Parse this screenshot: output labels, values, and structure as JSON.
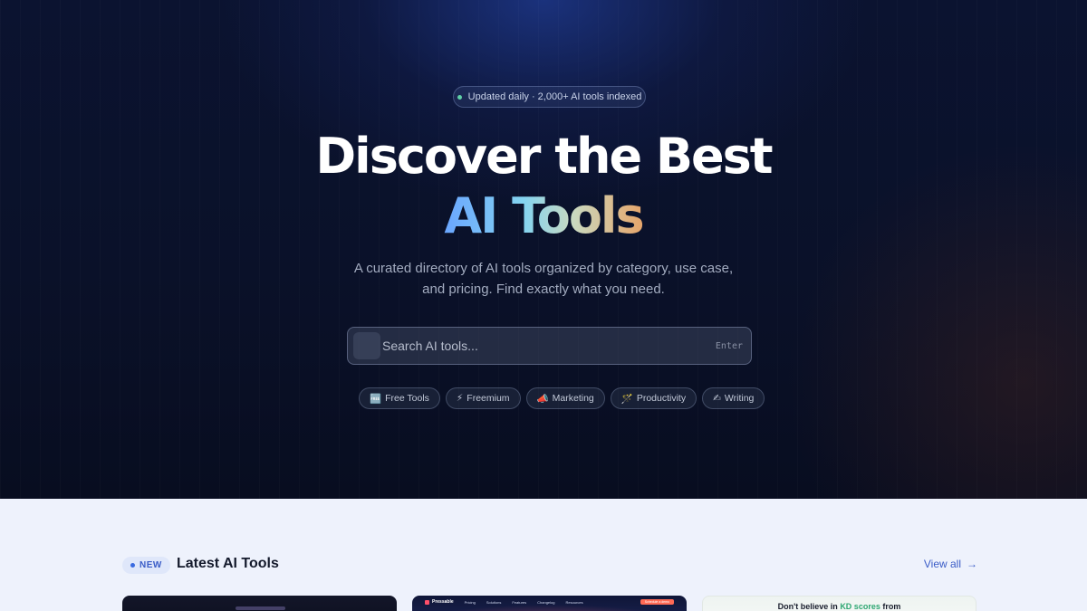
{
  "hero": {
    "badge": "Updated daily · 2,000+ AI tools indexed",
    "headline_line1": "Discover the Best",
    "headline_line2": "AI Tools",
    "subtitle_line1": "A curated directory of AI tools organized by category, use case,",
    "subtitle_line2": "and pricing. Find exactly what you need.",
    "search": {
      "placeholder": "Search AI tools...",
      "shortcut": "Enter"
    },
    "chips": [
      {
        "icon": "🆓",
        "label": "Free Tools"
      },
      {
        "icon": "⚡",
        "label": "Freemium"
      },
      {
        "icon": "📣",
        "label": "Marketing"
      },
      {
        "icon": "🪄",
        "label": "Productivity"
      },
      {
        "icon": "✍",
        "label": "Writing"
      }
    ]
  },
  "latest": {
    "badge": "NEW",
    "title": "Latest AI Tools",
    "view_all": "View all",
    "view_all_arrow": "→",
    "cards": [
      {
        "preview": "dark"
      },
      {
        "preview": "site",
        "brand": "Pressable",
        "nav": [
          "Pricing",
          "Solutions",
          "Features",
          "Changelog",
          "Resources"
        ],
        "cta": "Schedule a demo"
      },
      {
        "preview": "text",
        "text_a": "Don't believe in ",
        "highlight": "KD scores",
        "text_b": " from"
      }
    ]
  },
  "colors": {
    "accent": "#3a5cc7",
    "hero_bg": "#0a1129",
    "lower_bg": "#eef2fc",
    "gradient_start": "#6aa6ff",
    "gradient_end": "#e6a56a",
    "status_dot": "#5fd0a7"
  }
}
